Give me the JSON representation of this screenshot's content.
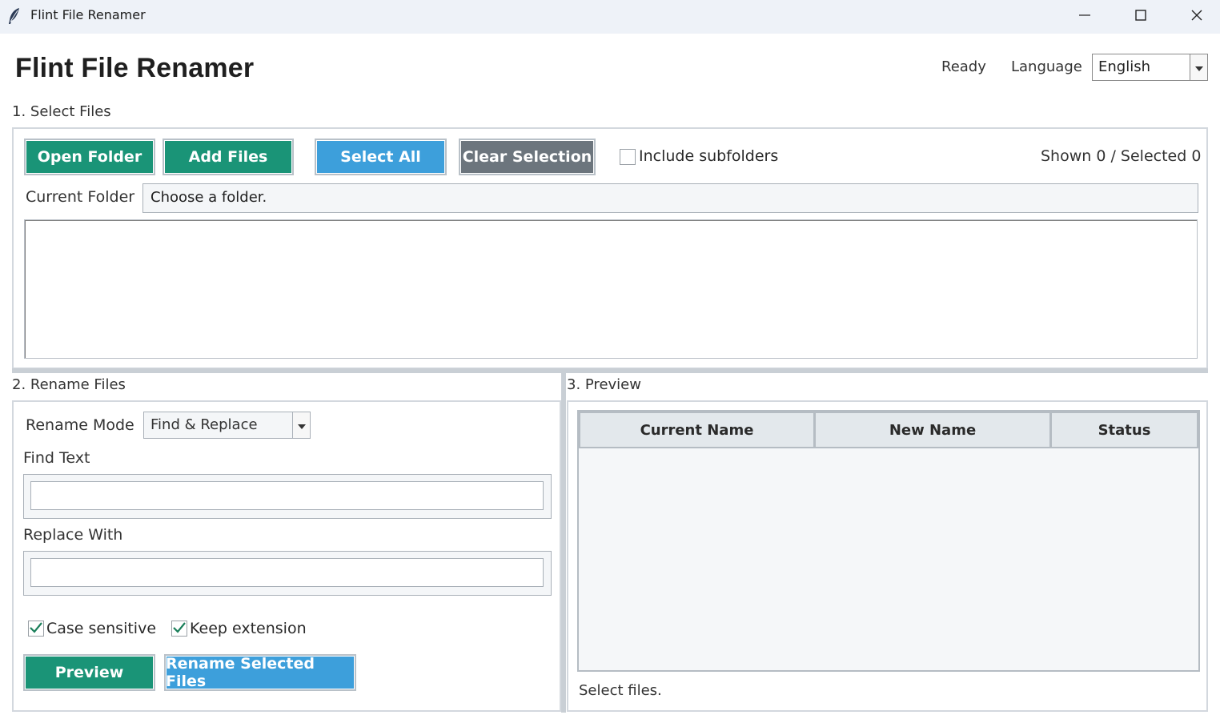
{
  "window": {
    "title": "Flint File Renamer",
    "app_icon": "feather-icon",
    "controls": [
      "minimize-icon",
      "maximize-icon",
      "close-icon"
    ]
  },
  "header": {
    "title": "Flint File Renamer",
    "status": "Ready",
    "language_label": "Language",
    "language_value": "English"
  },
  "select_files": {
    "section_label": "1. Select Files",
    "open_folder": "Open Folder",
    "add_files": "Add Files",
    "select_all": "Select All",
    "clear_selection": "Clear Selection",
    "include_subfolders": "Include subfolders",
    "include_subfolders_checked": false,
    "counts": "Shown 0 / Selected 0",
    "current_folder_label": "Current Folder",
    "current_folder_value": "Choose a folder."
  },
  "rename_files": {
    "section_label": "2. Rename Files",
    "mode_label": "Rename Mode",
    "mode_value": "Find & Replace",
    "find_label": "Find Text",
    "find_value": "",
    "replace_label": "Replace With",
    "replace_value": "",
    "case_sensitive": "Case sensitive",
    "case_sensitive_checked": true,
    "keep_extension": "Keep extension",
    "keep_extension_checked": true,
    "preview_button": "Preview",
    "rename_button": "Rename Selected Files"
  },
  "preview": {
    "section_label": "3. Preview",
    "columns": [
      "Current Name",
      "New Name",
      "Status"
    ],
    "rows": [],
    "status_text": "Select files."
  },
  "colors": {
    "green": "#1a9477",
    "blue": "#3d9fdb",
    "gray": "#6c757d",
    "titlebar": "#eef2f8"
  }
}
